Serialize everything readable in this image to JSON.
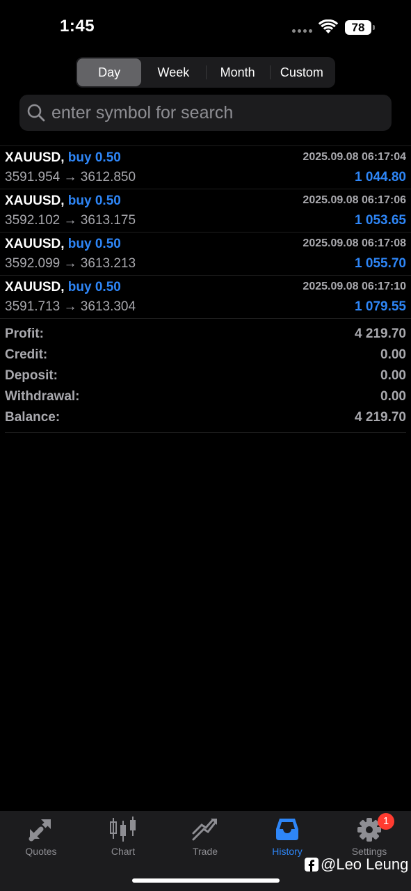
{
  "status_bar": {
    "time": "1:45",
    "battery": "78"
  },
  "period_tabs": [
    {
      "label": "Day",
      "active": true
    },
    {
      "label": "Week",
      "active": false
    },
    {
      "label": "Month",
      "active": false
    },
    {
      "label": "Custom",
      "active": false
    }
  ],
  "search": {
    "placeholder": "enter symbol for search",
    "value": ""
  },
  "deals": [
    {
      "symbol": "XAUUSD,",
      "side": "buy 0.50",
      "time": "2025.09.08 06:17:04",
      "prices": "3591.954 → 3612.850",
      "profit": "1 044.80"
    },
    {
      "symbol": "XAUUSD,",
      "side": "buy 0.50",
      "time": "2025.09.08 06:17:06",
      "prices": "3592.102 → 3613.175",
      "profit": "1 053.65"
    },
    {
      "symbol": "XAUUSD,",
      "side": "buy 0.50",
      "time": "2025.09.08 06:17:08",
      "prices": "3592.099 → 3613.213",
      "profit": "1 055.70"
    },
    {
      "symbol": "XAUUSD,",
      "side": "buy 0.50",
      "time": "2025.09.08 06:17:10",
      "prices": "3591.713 → 3613.304",
      "profit": "1 079.55"
    }
  ],
  "summary": [
    {
      "label": "Profit:",
      "value": "4 219.70"
    },
    {
      "label": "Credit:",
      "value": "0.00"
    },
    {
      "label": "Deposit:",
      "value": "0.00"
    },
    {
      "label": "Withdrawal:",
      "value": "0.00"
    },
    {
      "label": "Balance:",
      "value": "4 219.70"
    }
  ],
  "tab_bar": [
    {
      "label": "Quotes",
      "icon": "quotes-icon",
      "active": false
    },
    {
      "label": "Chart",
      "icon": "chart-icon",
      "active": false
    },
    {
      "label": "Trade",
      "icon": "trade-icon",
      "active": false
    },
    {
      "label": "History",
      "icon": "history-icon",
      "active": true
    },
    {
      "label": "Settings",
      "icon": "gear-icon",
      "active": false,
      "badge": "1"
    }
  ],
  "watermark": "@Leo Leung",
  "colors": {
    "accent": "#2e86f7",
    "background": "#000000",
    "muted": "#a9a9ae",
    "badge": "#ff3b30"
  }
}
